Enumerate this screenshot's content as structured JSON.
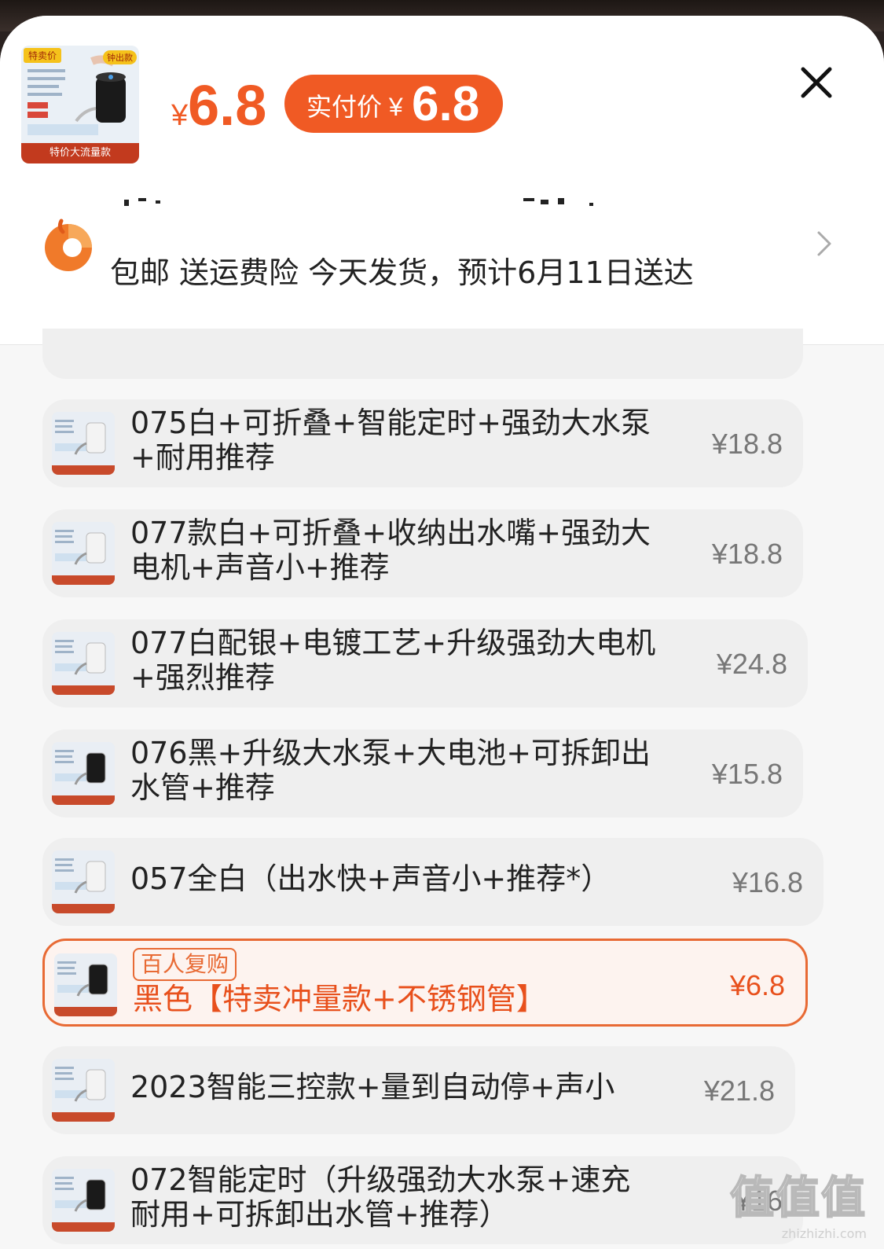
{
  "header": {
    "price_symbol": "¥",
    "price_value": "6.8",
    "pay_label": "实付价",
    "pay_symbol": "¥",
    "pay_value": "6.8",
    "thumb_badge": "特卖价",
    "thumb_badge2": "钟出款",
    "thumb_tag": "特价大流量款",
    "shipping_text": "包邮  送运费险  今天发货，预计6月11日送达"
  },
  "colors": {
    "accent": "#f05a24",
    "selected_border": "#e86a34",
    "row_bg": "#efefef"
  },
  "icons": {
    "close": "close-icon",
    "logo": "brand-logo-icon",
    "chevron": "chevron-right-icon"
  },
  "options": [
    {
      "title": "075白+可折叠+智能定时+强劲大水泵+耐用推荐",
      "price": "¥18.8"
    },
    {
      "title": "077款白+可折叠+收纳出水嘴+强劲大电机+声音小+推荐",
      "price": "¥18.8"
    },
    {
      "title": "077白配银+电镀工艺+升级强劲大电机+强烈推荐",
      "price": "¥24.8"
    },
    {
      "title": "076黑+升级大水泵+大电池+可拆卸出水管+推荐",
      "price": "¥15.8"
    },
    {
      "title": "057全白（出水快+声音小+推荐*）",
      "price": "¥16.8"
    },
    {
      "tag": "百人复购",
      "title": "黑色【特卖冲量款+不锈钢管】",
      "price": "¥6.8",
      "selected": true
    },
    {
      "title": "2023智能三控款+量到自动停+声小",
      "price": "¥21.8"
    },
    {
      "title": "072智能定时（升级强劲大水泵+速充耐用+可拆卸出水管+推荐）",
      "price": "¥16"
    }
  ],
  "watermark": {
    "big": "值值值",
    "small": "zhizhizhi.com"
  }
}
